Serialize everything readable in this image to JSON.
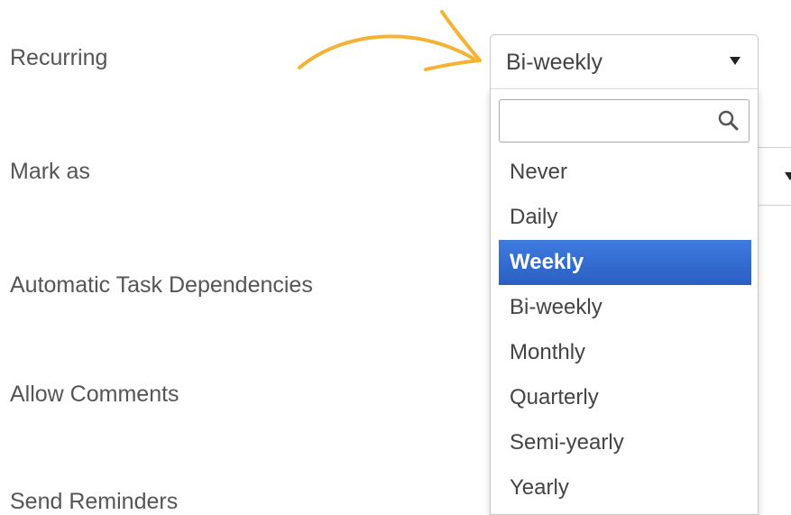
{
  "labels": {
    "recurring": "Recurring",
    "mark_as": "Mark as",
    "automatic_task_dependencies": "Automatic Task Dependencies",
    "allow_comments": "Allow Comments",
    "send_reminders": "Send Reminders"
  },
  "recurring_select": {
    "value": "Bi-weekly",
    "search_placeholder": "",
    "options": [
      "Never",
      "Daily",
      "Weekly",
      "Bi-weekly",
      "Monthly",
      "Quarterly",
      "Semi-yearly",
      "Yearly"
    ],
    "highlighted_option": "Weekly"
  },
  "icons": {
    "search": "search-icon",
    "caret": "caret-down-icon",
    "annotation_arrow": "annotation-arrow-icon"
  },
  "colors": {
    "arrow": "#f5b335",
    "highlight": "#3470d6",
    "label_text": "#555555"
  }
}
